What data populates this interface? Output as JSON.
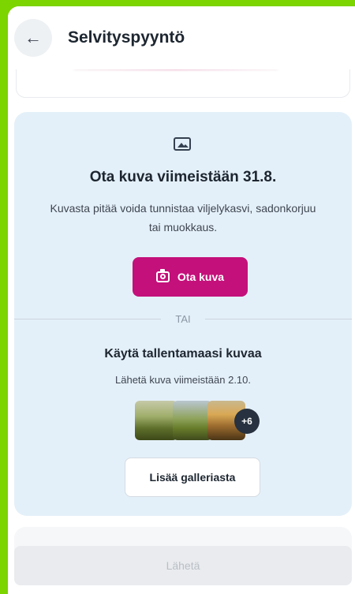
{
  "header": {
    "back_icon": "arrow-left-icon",
    "title": "Selvityspyyntö"
  },
  "photo_request": {
    "image_icon": "image-icon",
    "heading": "Ota kuva viimeistään 31.8.",
    "description": "Kuvasta pitää voida tunnistaa viljelykasvi, sadonkorjuu tai muokkaus.",
    "take_photo_label": "Ota kuva",
    "camera_icon": "camera-icon",
    "or_label": "TAI",
    "saved_heading": "Käytä tallentamaasi kuvaa",
    "saved_description": "Lähetä kuva viimeistään 2.10.",
    "more_count": "+6",
    "gallery_label": "Lisää galleriasta"
  },
  "footer": {
    "send_label": "Lähetä"
  },
  "colors": {
    "accent": "#c4107a",
    "card_background": "#e4f0f9",
    "frame": "#7cd400"
  }
}
